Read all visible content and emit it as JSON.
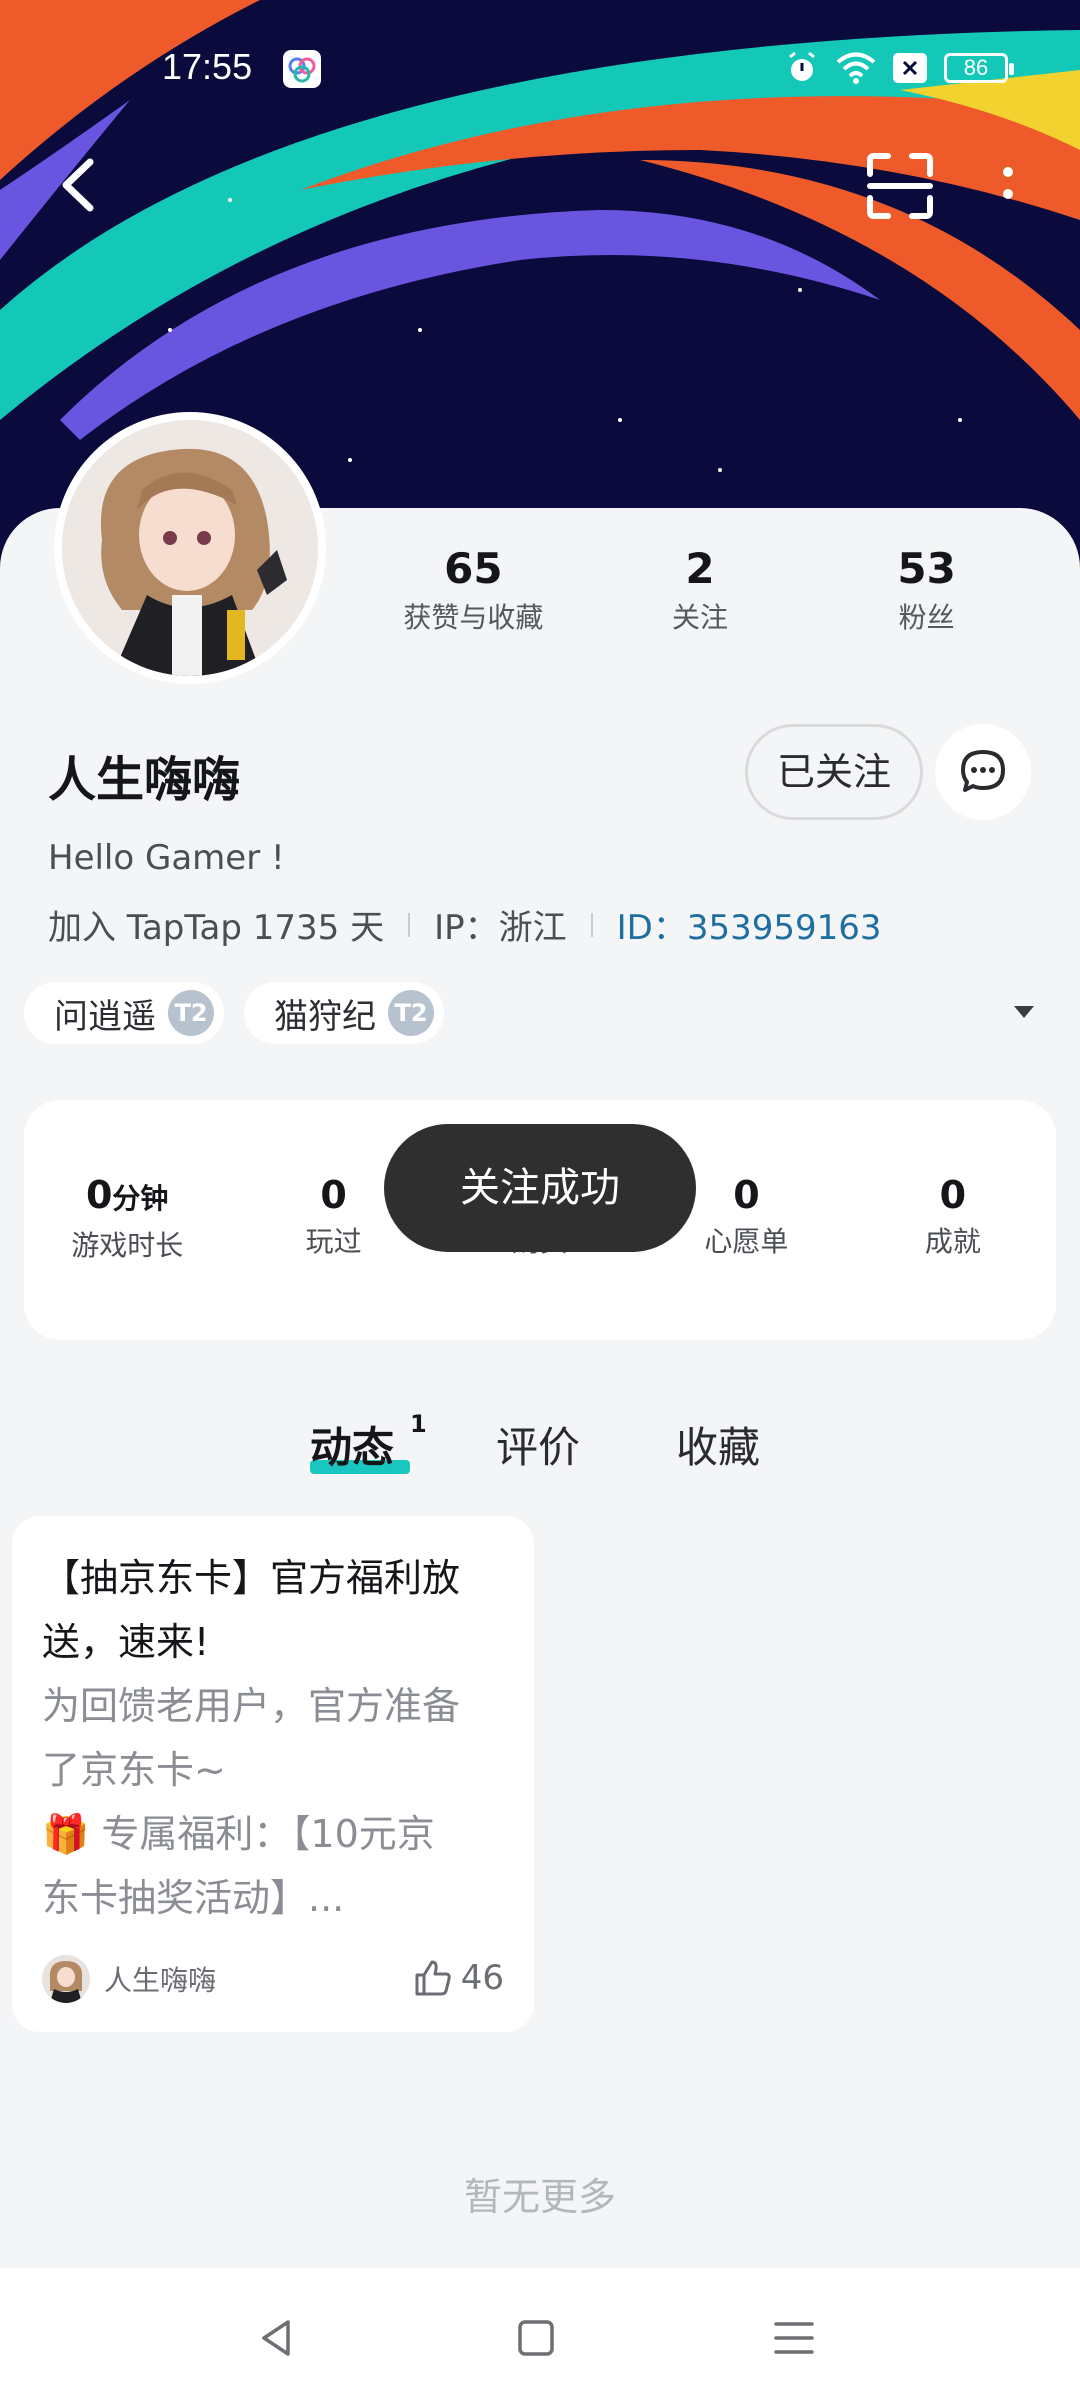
{
  "status_bar": {
    "time": "17:55",
    "battery": "86"
  },
  "nav": {
    "back_icon": "chevron-left-icon",
    "scan_icon": "scan-icon",
    "more_icon": "more-vertical-icon"
  },
  "profile": {
    "username": "人生嗨嗨",
    "bio": "Hello Gamer !",
    "join_text": "加入 TapTap 1735 天",
    "ip_text": "IP：浙江",
    "id_text": "ID：353959163",
    "follow_button": "已关注",
    "stats": [
      {
        "value": "65",
        "label": "获赞与收藏"
      },
      {
        "value": "2",
        "label": "关注"
      },
      {
        "value": "53",
        "label": "粉丝"
      }
    ]
  },
  "tags": [
    {
      "label": "问逍遥",
      "badge": "T2"
    },
    {
      "label": "猫狩纪",
      "badge": "T2"
    }
  ],
  "game_stats": [
    {
      "value": "0",
      "unit": "分钟",
      "label": "游戏时长"
    },
    {
      "value": "0",
      "unit": "",
      "label": "玩过"
    },
    {
      "value": "0",
      "unit": "",
      "label": "购买"
    },
    {
      "value": "0",
      "unit": "",
      "label": "心愿单"
    },
    {
      "value": "0",
      "unit": "",
      "label": "成就"
    }
  ],
  "toast": "关注成功",
  "tabs": [
    {
      "label": "动态",
      "count": "1"
    },
    {
      "label": "评价"
    },
    {
      "label": "收藏"
    }
  ],
  "post": {
    "title_line1": "【抽京东卡】官方福利放",
    "title_line2": "送，速来!",
    "body_line1": "为回馈老用户，官方准备",
    "body_line2": "了京东卡~",
    "body_line3": "🎁 专属福利：【10元京",
    "body_line4": "东卡抽奖活动】...",
    "author": "人生嗨嗨",
    "likes": "46"
  },
  "footer_text": "暂无更多",
  "colors": {
    "accent": "#19c7c0",
    "id_link": "#1e6fa0",
    "banner_bg": "#0b0a3c"
  }
}
